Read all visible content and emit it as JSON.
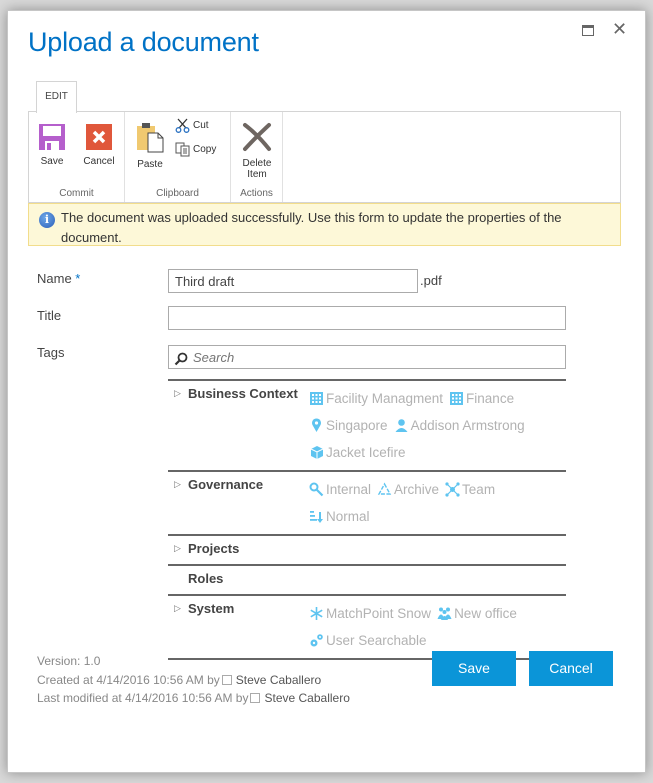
{
  "dialog": {
    "title": "Upload a document",
    "maximize_icon": "maximize-icon",
    "close_icon": "close-icon",
    "close_glyph": "✕"
  },
  "ribbon": {
    "tab": "EDIT",
    "groups": [
      {
        "label": "Commit",
        "buttons": [
          {
            "label": "Save",
            "icon": "save-icon"
          },
          {
            "label": "Cancel",
            "icon": "cancel-icon"
          }
        ]
      },
      {
        "label": "Clipboard",
        "buttons": [
          {
            "label": "Paste",
            "icon": "paste-icon"
          },
          {
            "label": "Cut",
            "icon": "cut-icon"
          },
          {
            "label": "Copy",
            "icon": "copy-icon"
          }
        ]
      },
      {
        "label": "Actions",
        "buttons": [
          {
            "label": "Delete Item",
            "label_line1": "Delete",
            "label_line2": "Item",
            "icon": "delete-icon"
          }
        ]
      }
    ]
  },
  "info": {
    "icon": "info-icon",
    "glyph": "i",
    "message": "The document was uploaded successfully. Use this form to update the properties of the document."
  },
  "form": {
    "name": {
      "label": "Name",
      "required_marker": " *",
      "value": "Third draft",
      "extension": ".pdf"
    },
    "title": {
      "label": "Title",
      "value": ""
    },
    "tags": {
      "label": "Tags",
      "placeholder": "Search"
    }
  },
  "taxonomy": [
    {
      "name": "Business Context",
      "expandable": true,
      "terms": [
        {
          "label": "Facility Managment",
          "icon": "building-icon"
        },
        {
          "label": "Finance",
          "icon": "building-icon"
        },
        {
          "label": "Singapore",
          "icon": "location-pin-icon"
        },
        {
          "label": "Addison Armstrong",
          "icon": "person-icon"
        },
        {
          "label": "Jacket Icefire",
          "icon": "product-box-icon"
        }
      ]
    },
    {
      "name": "Governance",
      "expandable": true,
      "terms": [
        {
          "label": "Internal",
          "icon": "key-icon"
        },
        {
          "label": "Archive",
          "icon": "recycle-icon"
        },
        {
          "label": "Team",
          "icon": "network-icon"
        },
        {
          "label": "Normal",
          "icon": "priority-icon"
        }
      ]
    },
    {
      "name": "Projects",
      "expandable": true,
      "terms": []
    },
    {
      "name": "Roles",
      "expandable": false,
      "terms": []
    },
    {
      "name": "System",
      "expandable": true,
      "terms": [
        {
          "label": "MatchPoint Snow",
          "icon": "snowflake-icon"
        },
        {
          "label": "New office",
          "icon": "group-icon"
        },
        {
          "label": "User Searchable",
          "icon": "gears-icon"
        }
      ]
    }
  ],
  "footer": {
    "version": "Version: 1.0",
    "created": {
      "prefix": "Created at 4/14/2016 10:56 AM  by",
      "user": "Steve Caballero"
    },
    "modified": {
      "prefix": "Last modified at 4/14/2016 10:56 AM  by",
      "user": "Steve Caballero"
    },
    "save_label": "Save",
    "cancel_label": "Cancel"
  },
  "colors": {
    "title": "#0072c6",
    "primary_button": "#0b95d8",
    "info_bg": "#fdf8d8",
    "term_icon": "#5ec4f0",
    "term_text": "#b2b2b2"
  }
}
